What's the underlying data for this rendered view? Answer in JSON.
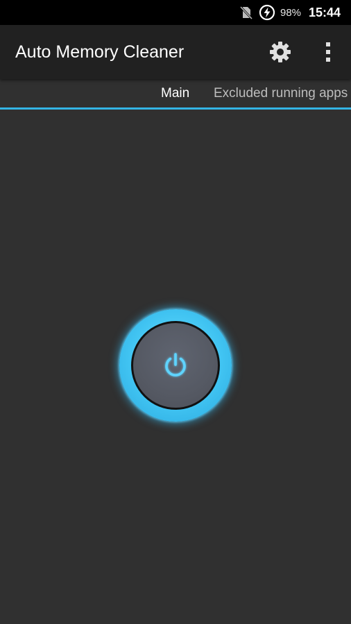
{
  "status_bar": {
    "battery_percent": "98%",
    "time": "15:44",
    "icons": [
      "no-sim-icon",
      "battery-charging-icon"
    ]
  },
  "app_bar": {
    "title": "Auto Memory Cleaner",
    "actions": [
      "gear-icon",
      "more-vert-icon"
    ]
  },
  "tabs": [
    {
      "label": "Main",
      "selected": true
    },
    {
      "label": "Excluded running apps",
      "selected": false
    }
  ],
  "main": {
    "power_button_icon": "power-icon"
  },
  "colors": {
    "accent": "#33b5e5",
    "background": "#303030",
    "app_bar": "#212121",
    "status_bar": "#000000"
  }
}
